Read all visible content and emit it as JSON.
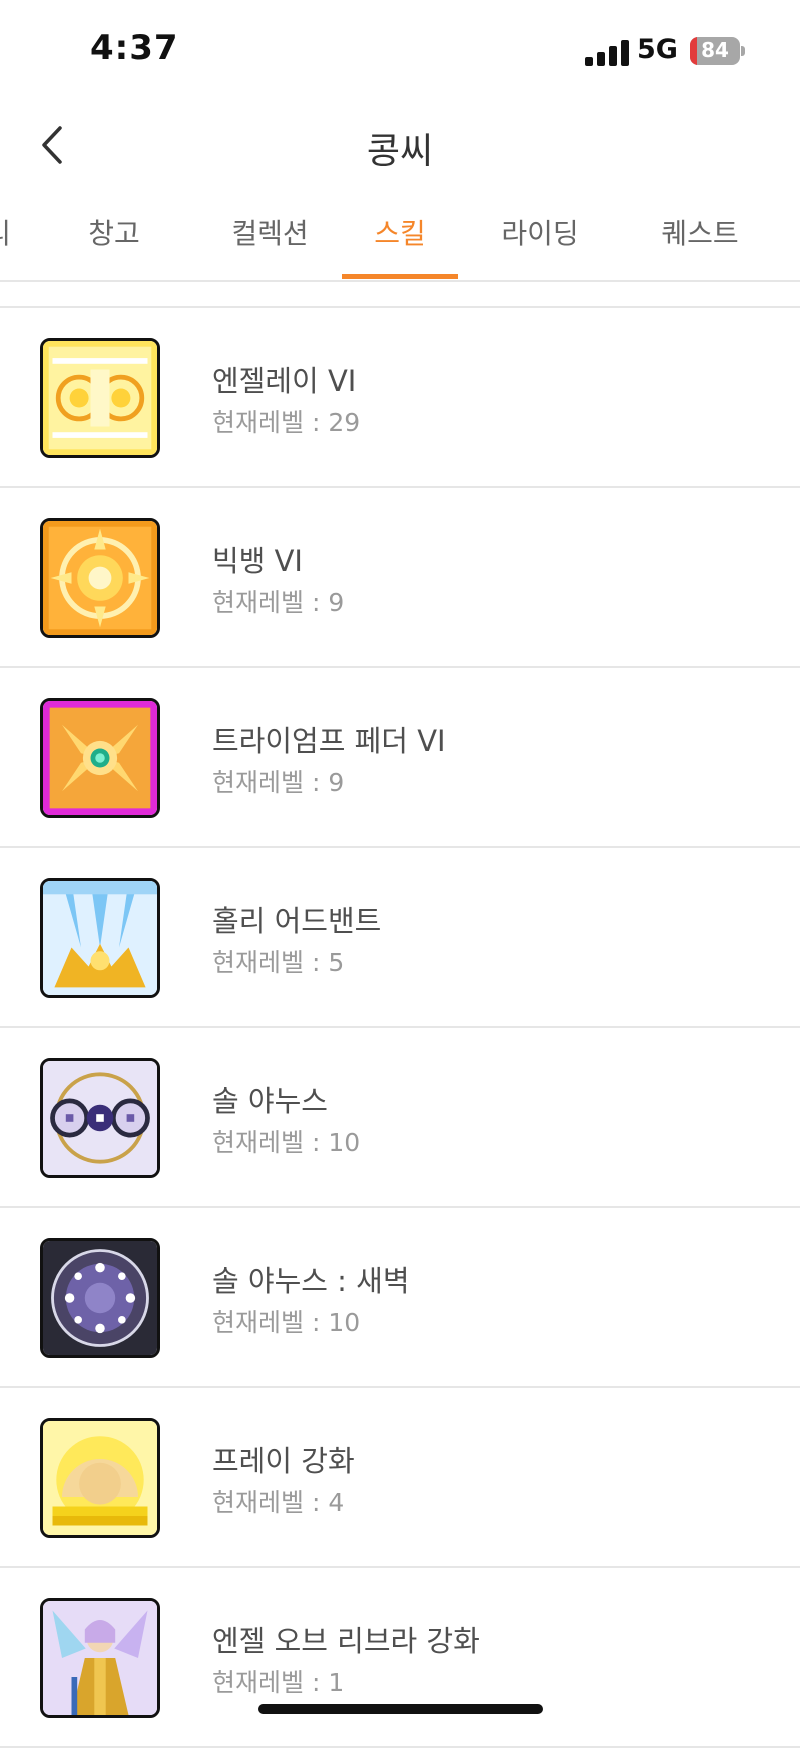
{
  "status_bar": {
    "time": "4:37",
    "network": "5G",
    "battery": "84"
  },
  "header": {
    "title": "콩씨"
  },
  "tabs": [
    {
      "label": "리",
      "active": false
    },
    {
      "label": "창고",
      "active": false
    },
    {
      "label": "컬렉션",
      "active": false
    },
    {
      "label": "스킬",
      "active": true
    },
    {
      "label": "라이딩",
      "active": false
    },
    {
      "label": "퀘스트",
      "active": false
    }
  ],
  "level_label": "현재레벨 : ",
  "skills": [
    {
      "name": "엔젤레이 VI",
      "level": "29",
      "icon": "angel-ray-icon"
    },
    {
      "name": "빅뱅 VI",
      "level": "9",
      "icon": "big-bang-icon"
    },
    {
      "name": "트라이엄프 페더 VI",
      "level": "9",
      "icon": "triumph-feather-icon"
    },
    {
      "name": "홀리 어드밴트",
      "level": "5",
      "icon": "holy-advent-icon"
    },
    {
      "name": "솔 야누스",
      "level": "10",
      "icon": "sol-janus-icon"
    },
    {
      "name": "솔 야누스 : 새벽",
      "level": "10",
      "icon": "sol-janus-dawn-icon"
    },
    {
      "name": "프레이 강화",
      "level": "4",
      "icon": "pray-enhance-icon"
    },
    {
      "name": "엔젤 오브 리브라 강화",
      "level": "1",
      "icon": "angel-of-libra-icon"
    }
  ],
  "colors": {
    "accent": "#f5862a"
  }
}
